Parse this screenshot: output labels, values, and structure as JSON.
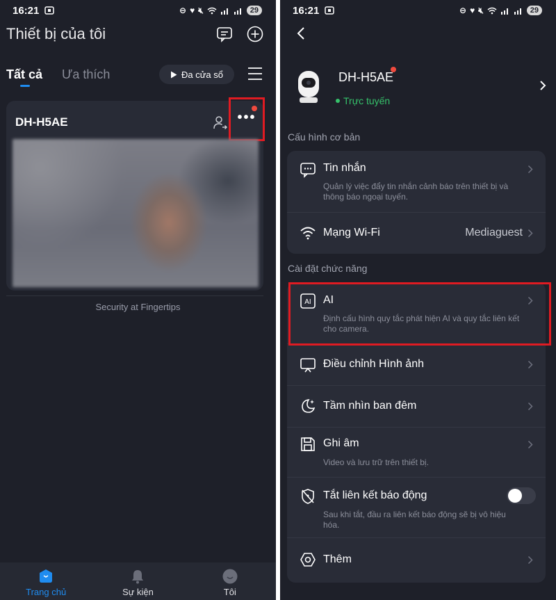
{
  "status_bar": {
    "time": "16:21",
    "battery": "29"
  },
  "left": {
    "page_title": "Thiết bị của tôi",
    "tabs": [
      {
        "label": "Tất cả",
        "active": true
      },
      {
        "label": "Ưa thích",
        "active": false
      }
    ],
    "multi_window_label": "Đa cửa sổ",
    "device": {
      "name": "DH-H5AE"
    },
    "tagline": "Security at Fingertips",
    "nav": [
      {
        "label": "Trang chủ",
        "icon": "home-icon",
        "active": true
      },
      {
        "label": "Sự kiện",
        "icon": "bell-icon",
        "active": false
      },
      {
        "label": "Tôi",
        "icon": "profile-icon",
        "active": false
      }
    ]
  },
  "right": {
    "device_name": "DH-H5AE",
    "device_status": "Trực tuyến",
    "section_basic": "Cấu hình cơ bản",
    "section_features": "Cài đặt chức năng",
    "messages": {
      "title": "Tin nhắn",
      "desc": "Quản lý việc đẩy tin nhắn cảnh báo trên thiết bị và thông báo ngoại tuyến."
    },
    "wifi": {
      "title": "Mạng Wi-Fi",
      "value": "Mediaguest"
    },
    "ai": {
      "icon_text": "AI",
      "title": "AI",
      "desc": "Định cấu hình quy tắc phát hiện AI và quy tắc liên kết cho camera."
    },
    "image_adjust": {
      "title": "Điều chỉnh Hình ảnh"
    },
    "night_vision": {
      "title": "Tầm nhìn ban đêm"
    },
    "recording": {
      "title": "Ghi âm",
      "desc": "Video và lưu trữ trên thiết bị."
    },
    "alarm_link": {
      "title": "Tắt liên kết báo động",
      "desc": "Sau khi tắt, đầu ra liên kết báo động sẽ bị vô hiệu hóa.",
      "enabled": false
    },
    "more": {
      "title": "Thêm"
    }
  },
  "colors": {
    "background": "#1e2029",
    "card": "#292c37",
    "accent": "#1f8cf0",
    "highlight": "#e01b22",
    "online": "#36c26b",
    "notification_dot": "#f04a3e"
  }
}
